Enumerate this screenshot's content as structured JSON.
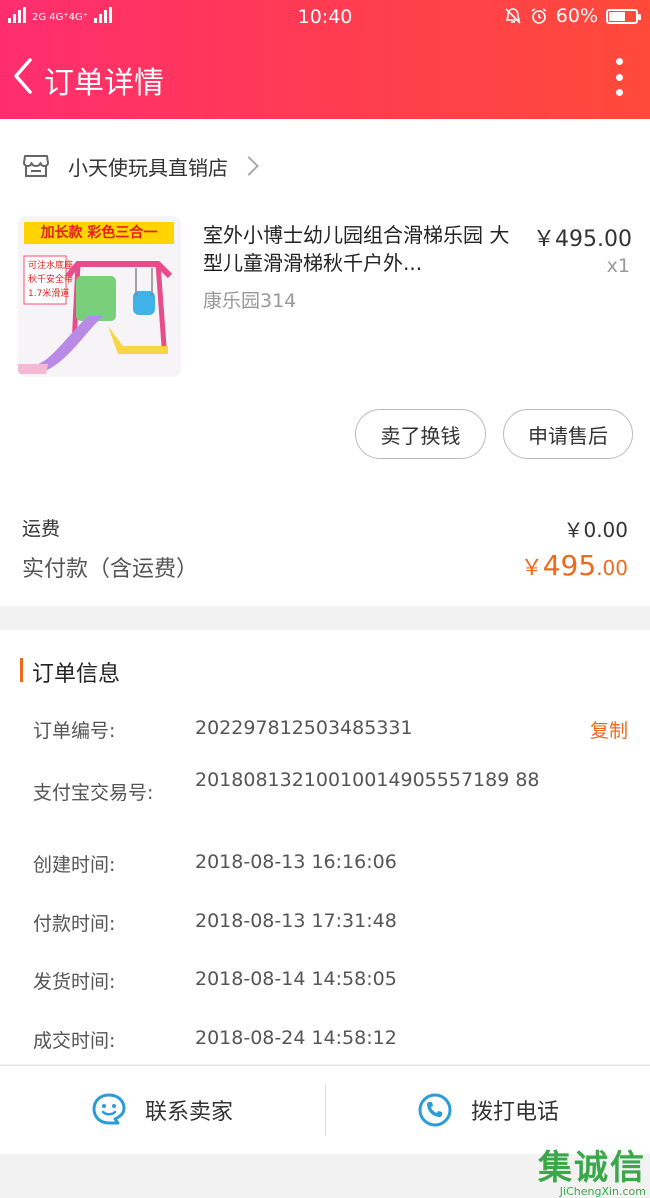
{
  "status_bar": {
    "left_text": "2G 4G⁺4G⁺",
    "time": "10:40",
    "battery": "60%",
    "battery_level": 0.6
  },
  "nav": {
    "title": "订单详情"
  },
  "shop": {
    "name": "小天使玩具直销店"
  },
  "product": {
    "image_banner": "加长款 彩色三合一",
    "title": "室外小博士幼儿园组合滑梯乐园 大型儿童滑滑梯秋千户外...",
    "sku": "康乐园314",
    "price": "￥495.00",
    "qty": "x1"
  },
  "actions": {
    "resell": "卖了换钱",
    "after_sale": "申请售后"
  },
  "totals": {
    "shipping_label": "运费",
    "shipping_value": "￥0.00",
    "paid_label": "实付款（含运费）",
    "paid_currency": "￥",
    "paid_int": "495",
    "paid_dec": ".00"
  },
  "order_info": {
    "heading": "订单信息",
    "copy": "复制",
    "rows": [
      {
        "label": "订单编号:",
        "value": "202297812503485331"
      },
      {
        "label": "支付宝交易号:",
        "value": "20180813210010014905557189 88"
      },
      {
        "label": "创建时间:",
        "value": "2018-08-13 16:16:06"
      },
      {
        "label": "付款时间:",
        "value": "2018-08-13 17:31:48"
      },
      {
        "label": "发货时间:",
        "value": "2018-08-14 14:58:05"
      },
      {
        "label": "成交时间:",
        "value": "2018-08-24 14:58:12"
      }
    ]
  },
  "bottom": {
    "contact": "联系卖家",
    "call": "拨打电话"
  },
  "watermark": {
    "main": "集诚信",
    "sub": "JiChengXin.com"
  },
  "colors": {
    "header_start": "#ff2d6f",
    "header_end": "#ff4a3a",
    "accent_orange": "#ee6a1c",
    "icon_blue": "#2b9cd8"
  }
}
